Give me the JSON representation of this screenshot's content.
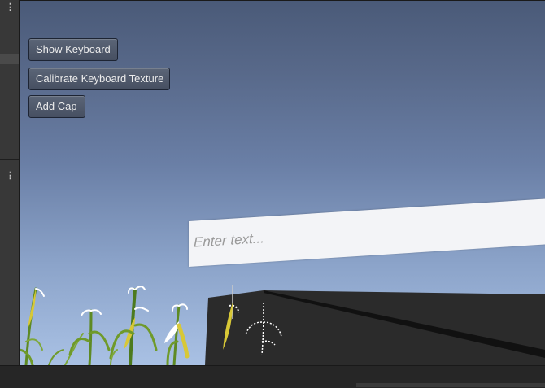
{
  "buttons": {
    "show_keyboard": "Show Keyboard",
    "calibrate": "Calibrate Keyboard Texture",
    "add_cap": "Add Cap"
  },
  "input": {
    "placeholder": "Enter text..."
  },
  "strip": {
    "menu_glyph": "⋮"
  },
  "colors": {
    "sky_top": "#4a5a78",
    "sky_bottom": "#a9c1e4",
    "ground": "#2b2b2b",
    "plant_green": "#6f9a2a",
    "plant_yellow": "#d8c836"
  }
}
